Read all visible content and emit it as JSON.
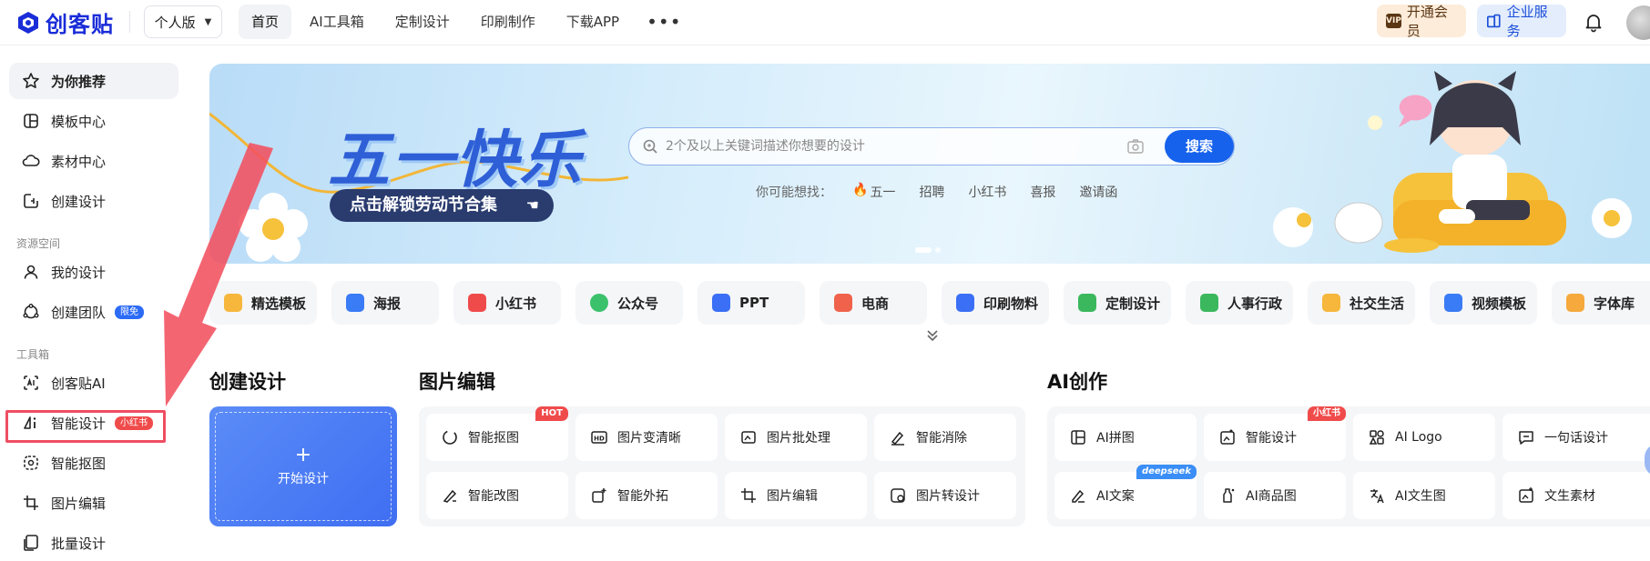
{
  "header": {
    "logo_text": "创客贴",
    "version": "个人版",
    "nav": [
      "首页",
      "AI工具箱",
      "定制设计",
      "印刷制作",
      "下载APP"
    ],
    "nav_more": "•••",
    "vip_icon_text": "VIP",
    "vip_label": "开通会员",
    "enterprise_label": "企业服务"
  },
  "sidebar": {
    "items_top": [
      "为你推荐",
      "模板中心",
      "素材中心",
      "创建设计"
    ],
    "section_space": "资源空间",
    "items_space": [
      "我的设计",
      "创建团队"
    ],
    "team_badge": "限免",
    "section_tools": "工具箱",
    "items_tools": [
      "创客贴AI",
      "智能设计",
      "智能抠图",
      "图片编辑",
      "批量设计"
    ],
    "smart_design_badge": "小红书"
  },
  "banner": {
    "title": "五一快乐",
    "subtitle": "点击解锁劳动节合集",
    "search_placeholder": "2个及以上关键词描述你想要的设计",
    "search_button": "搜索",
    "suggest_lead": "你可能想找：",
    "suggest_keywords": [
      "五一",
      "招聘",
      "小红书",
      "喜报",
      "邀请函"
    ]
  },
  "categories": [
    {
      "label": "精选模板",
      "color": "#f6b73c"
    },
    {
      "label": "海报",
      "color": "#3a7bf6"
    },
    {
      "label": "小红书",
      "color": "#f04b4b"
    },
    {
      "label": "公众号",
      "color": "#3bc16b"
    },
    {
      "label": "PPT",
      "color": "#3a6ff6"
    },
    {
      "label": "电商",
      "color": "#f0624b"
    },
    {
      "label": "印刷物料",
      "color": "#3a6ff6"
    },
    {
      "label": "定制设计",
      "color": "#3bb85e"
    },
    {
      "label": "人事行政",
      "color": "#3bb85e"
    },
    {
      "label": "社交生活",
      "color": "#f6b73c"
    },
    {
      "label": "视频模板",
      "color": "#3a7bf6"
    },
    {
      "label": "字体库",
      "color": "#f6a93c"
    }
  ],
  "sections": {
    "create_title": "创建设计",
    "create_plus": "+",
    "create_label": "开始设计",
    "image_title": "图片编辑",
    "image_tools": [
      "智能抠图",
      "图片变清晰",
      "图片批处理",
      "智能消除",
      "智能改图",
      "智能外拓",
      "图片编辑",
      "图片转设计"
    ],
    "image_hot_tag": "HOT",
    "ai_title": "AI创作",
    "ai_tools": [
      "AI拼图",
      "智能设计",
      "AI Logo",
      "一句话设计",
      "AI文案",
      "AI商品图",
      "AI文生图",
      "文生素材"
    ],
    "ai_xhs_tag": "小红书",
    "ai_ds_tag": "deepseek"
  },
  "colors": {
    "brand": "#1a2cd8",
    "accent": "#1662ec",
    "highlight": "#ee4e62"
  }
}
